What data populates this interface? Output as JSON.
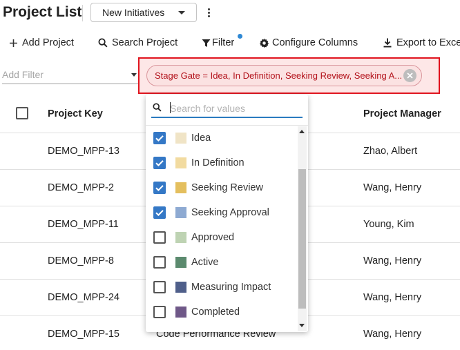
{
  "header": {
    "title": "Project List",
    "view_selector": "New Initiatives"
  },
  "toolbar": {
    "add_project": "Add Project",
    "search_project": "Search Project",
    "filter": "Filter",
    "configure_columns": "Configure Columns",
    "export": "Export to Exce"
  },
  "filter_bar": {
    "add_filter_placeholder": "Add Filter",
    "chip_text": "Stage Gate = Idea, In Definition, Seeking Review, Seeking A..."
  },
  "table": {
    "columns": [
      "Project Key",
      "Project Manager"
    ],
    "rows": [
      {
        "key": "DEMO_MPP-13",
        "name": "",
        "manager": "Zhao, Albert"
      },
      {
        "key": "DEMO_MPP-2",
        "name": "",
        "manager": "Wang, Henry"
      },
      {
        "key": "DEMO_MPP-11",
        "name": "",
        "manager": "Young, Kim"
      },
      {
        "key": "DEMO_MPP-8",
        "name": "",
        "manager": "Wang, Henry"
      },
      {
        "key": "DEMO_MPP-24",
        "name": "",
        "manager": "Wang, Henry"
      },
      {
        "key": "DEMO_MPP-15",
        "name": "Code Performance Review",
        "manager": "Wang, Henry"
      }
    ]
  },
  "dropdown": {
    "search_placeholder": "Search for values",
    "options": [
      {
        "label": "Idea",
        "checked": true,
        "color": "#f0e4c6"
      },
      {
        "label": "In Definition",
        "checked": true,
        "color": "#f2dba0"
      },
      {
        "label": "Seeking Review",
        "checked": true,
        "color": "#e4bf5e"
      },
      {
        "label": "Seeking Approval",
        "checked": true,
        "color": "#8eaad2"
      },
      {
        "label": "Approved",
        "checked": false,
        "color": "#bed3b3"
      },
      {
        "label": "Active",
        "checked": false,
        "color": "#5b8a6e"
      },
      {
        "label": "Measuring Impact",
        "checked": false,
        "color": "#4f5f8a"
      },
      {
        "label": "Completed",
        "checked": false,
        "color": "#6f5888"
      }
    ]
  },
  "colors": {
    "accent": "#2e88d4",
    "checkbox_blue": "#3478c6",
    "highlight_red": "#e0141e"
  }
}
